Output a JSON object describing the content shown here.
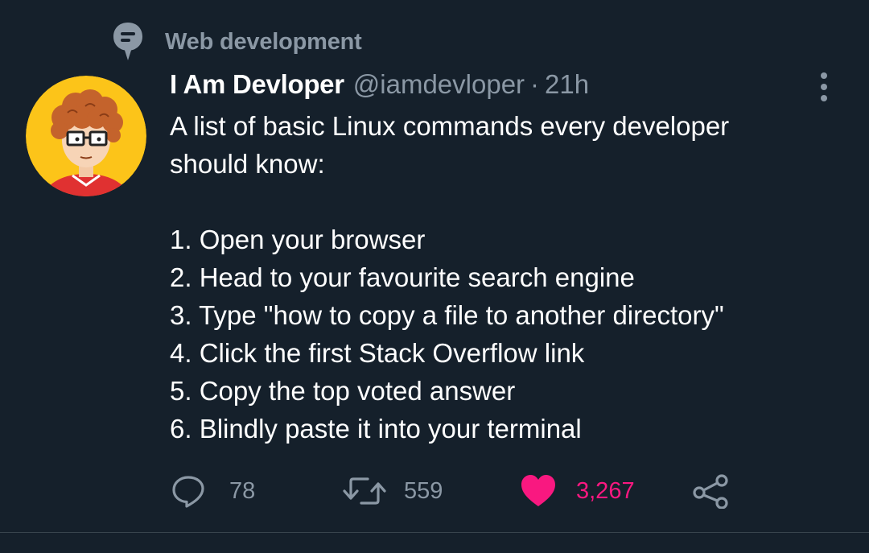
{
  "colors": {
    "background": "#15202b",
    "secondary_text": "#8b98a5",
    "primary_text": "#ffffff",
    "like_accent": "#f91880",
    "divider": "#38444d"
  },
  "topic": {
    "icon": "topic-bubble-icon",
    "label": "Web development"
  },
  "tweet": {
    "author_name": "I Am Devloper",
    "author_handle": "@iamdevloper",
    "separator": "·",
    "timestamp": "21h",
    "avatar_icon": "avatar-nerd-illustration",
    "more_icon": "more-vertical-icon",
    "body": {
      "intro_line1": "A list of basic Linux commands every developer",
      "intro_line2": "should know:",
      "steps": [
        "1. Open your browser",
        "2. Head to your favourite search engine",
        "3. Type \"how to copy a file to another directory\"",
        "4. Click the first Stack Overflow link",
        "5. Copy the top voted answer",
        "6. Blindly paste it into your terminal"
      ]
    },
    "actions": {
      "reply": {
        "icon": "reply-bubble-icon",
        "count": "78"
      },
      "retweet": {
        "icon": "retweet-icon",
        "count": "559"
      },
      "like": {
        "icon": "heart-filled-icon",
        "count": "3,267",
        "liked": true
      },
      "share": {
        "icon": "share-icon"
      }
    }
  }
}
